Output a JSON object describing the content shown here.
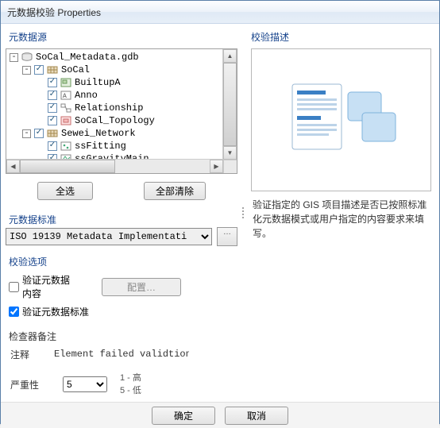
{
  "titlebar": "元数据校验 Properties",
  "left": {
    "source_title": "元数据源",
    "tree": {
      "root": "SoCal_Metadata.gdb",
      "groups": [
        {
          "label": "SoCal",
          "items": [
            {
              "label": "BuiltupA"
            },
            {
              "label": "Anno"
            },
            {
              "label": "Relationship"
            },
            {
              "label": "SoCal_Topology"
            }
          ]
        },
        {
          "label": "Sewei_Network",
          "items": [
            {
              "label": "ssFitting"
            },
            {
              "label": "ssGravityMain"
            }
          ]
        }
      ]
    },
    "select_all": "全选",
    "clear_all": "全部清除",
    "standard_title": "元数据标准",
    "standard_value": "ISO 19139 Metadata Implementati",
    "options_title": "校验选项",
    "validate_content": "验证元数据\n内容",
    "configure": "配置…",
    "validate_schema": "验证元数据标准",
    "inspector_title": "检查器备注",
    "annotation_label": "注释",
    "annotation_value": "Element failed validtion",
    "severity_label": "严重性",
    "severity_value": "5",
    "severity_high": "1 - 高",
    "severity_low": "5 - 低"
  },
  "right": {
    "title": "校验描述",
    "description": "验证指定的 GIS 项目描述是否已按照标准化元数据模式或用户指定的内容要求来填写。"
  },
  "bottom": {
    "ok": "确定",
    "cancel": "取消"
  }
}
